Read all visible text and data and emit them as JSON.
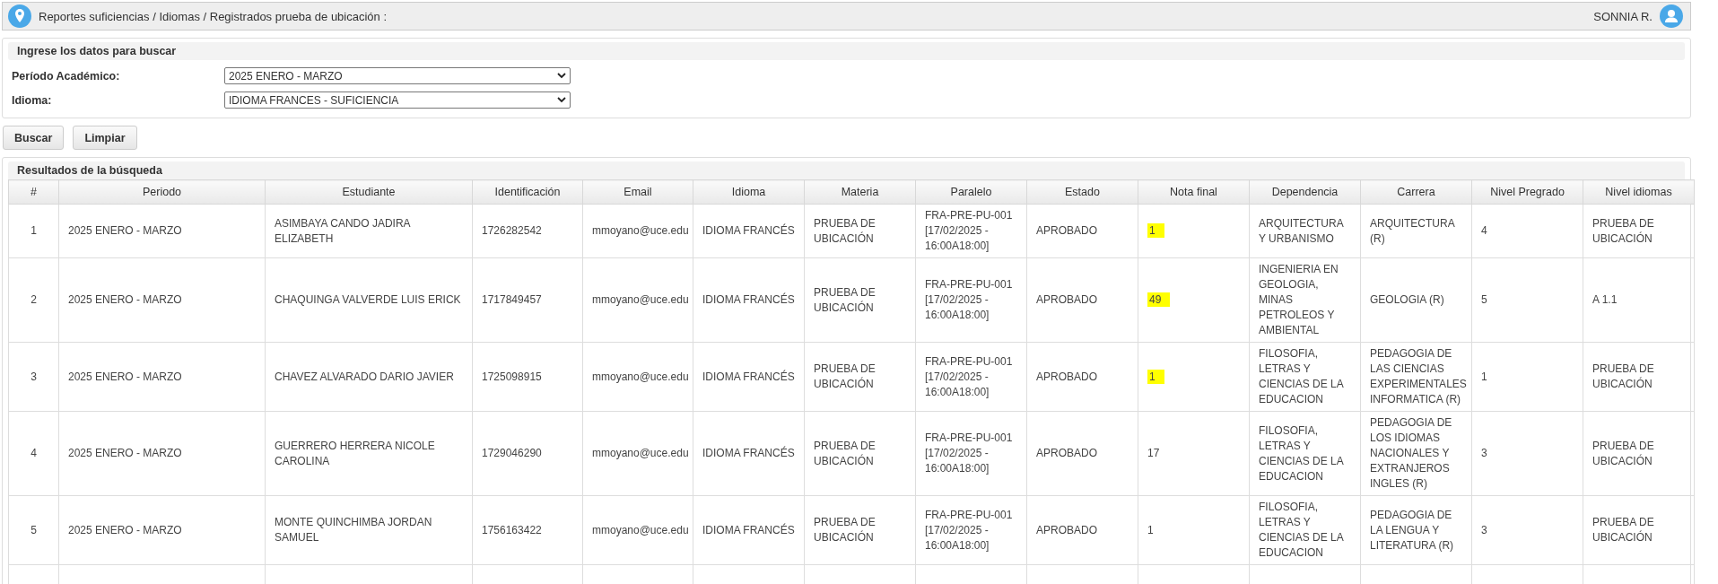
{
  "breadcrumb": "Reportes suficiencias / Idiomas / Registrados prueba de ubicación :",
  "user": "SONNIA R.",
  "search_panel": {
    "title": "Ingrese los datos para buscar",
    "fields": [
      {
        "label": "Período Académico:",
        "value": "2025 ENERO - MARZO"
      },
      {
        "label": "Idioma:",
        "value": "IDIOMA FRANCES - SUFICIENCIA"
      }
    ]
  },
  "buttons": [
    "Buscar",
    "Limpiar"
  ],
  "results": {
    "title": "Resultados de la búsqueda",
    "columns": [
      "#",
      "Periodo",
      "Estudiante",
      "Identificación",
      "Email",
      "Idioma",
      "Materia",
      "Paralelo",
      "Estado",
      "Nota final",
      "Dependencia",
      "Carrera",
      "Nivel Pregrado",
      "Nivel idiomas"
    ],
    "rows": [
      {
        "cells": [
          "1",
          "2025 ENERO - MARZO",
          "ASIMBAYA CANDO JADIRA ELIZABETH",
          "1726282542",
          "mmoyano@uce.edu",
          "IDIOMA FRANCÉS",
          "PRUEBA DE UBICACIÓN",
          "FRA-PRE-PU-001 [17/02/2025 - 16:00A18:00]",
          "APROBADO",
          "1",
          "ARQUITECTURA Y URBANISMO",
          "ARQUITECTURA (R)",
          "4",
          "PRUEBA DE UBICACIÓN"
        ],
        "nota_highlighted": true
      },
      {
        "cells": [
          "2",
          "2025 ENERO - MARZO",
          "CHAQUINGA VALVERDE LUIS ERICK",
          "1717849457",
          "mmoyano@uce.edu",
          "IDIOMA FRANCÉS",
          "PRUEBA DE UBICACIÓN",
          "FRA-PRE-PU-001 [17/02/2025 - 16:00A18:00]",
          "APROBADO",
          "49",
          "INGENIERIA EN GEOLOGIA, MINAS PETROLEOS Y AMBIENTAL",
          "GEOLOGIA (R)",
          "5",
          "A 1.1"
        ],
        "nota_highlighted": true
      },
      {
        "cells": [
          "3",
          "2025 ENERO - MARZO",
          "CHAVEZ ALVARADO DARIO JAVIER",
          "1725098915",
          "mmoyano@uce.edu",
          "IDIOMA FRANCÉS",
          "PRUEBA DE UBICACIÓN",
          "FRA-PRE-PU-001 [17/02/2025 - 16:00A18:00]",
          "APROBADO",
          "1",
          "FILOSOFIA, LETRAS Y CIENCIAS DE LA EDUCACION",
          "PEDAGOGIA DE LAS CIENCIAS EXPERIMENTALES INFORMATICA (R)",
          "1",
          "PRUEBA DE UBICACIÓN"
        ],
        "nota_highlighted": true
      },
      {
        "cells": [
          "4",
          "2025 ENERO - MARZO",
          "GUERRERO HERRERA NICOLE CAROLINA",
          "1729046290",
          "mmoyano@uce.edu",
          "IDIOMA FRANCÉS",
          "PRUEBA DE UBICACIÓN",
          "FRA-PRE-PU-001 [17/02/2025 - 16:00A18:00]",
          "APROBADO",
          "17",
          "FILOSOFIA, LETRAS Y CIENCIAS DE LA EDUCACION",
          "PEDAGOGIA DE LOS IDIOMAS NACIONALES Y EXTRANJEROS INGLES (R)",
          "3",
          "PRUEBA DE UBICACIÓN"
        ],
        "nota_highlighted": false
      },
      {
        "cells": [
          "5",
          "2025 ENERO - MARZO",
          "MONTE QUINCHIMBA JORDAN SAMUEL",
          "1756163422",
          "mmoyano@uce.edu",
          "IDIOMA FRANCÉS",
          "PRUEBA DE UBICACIÓN",
          "FRA-PRE-PU-001 [17/02/2025 - 16:00A18:00]",
          "APROBADO",
          "1",
          "FILOSOFIA, LETRAS Y CIENCIAS DE LA EDUCACION",
          "PEDAGOGIA DE LA LENGUA Y LITERATURA (R)",
          "3",
          "PRUEBA DE UBICACIÓN"
        ],
        "nota_highlighted": false
      }
    ]
  }
}
